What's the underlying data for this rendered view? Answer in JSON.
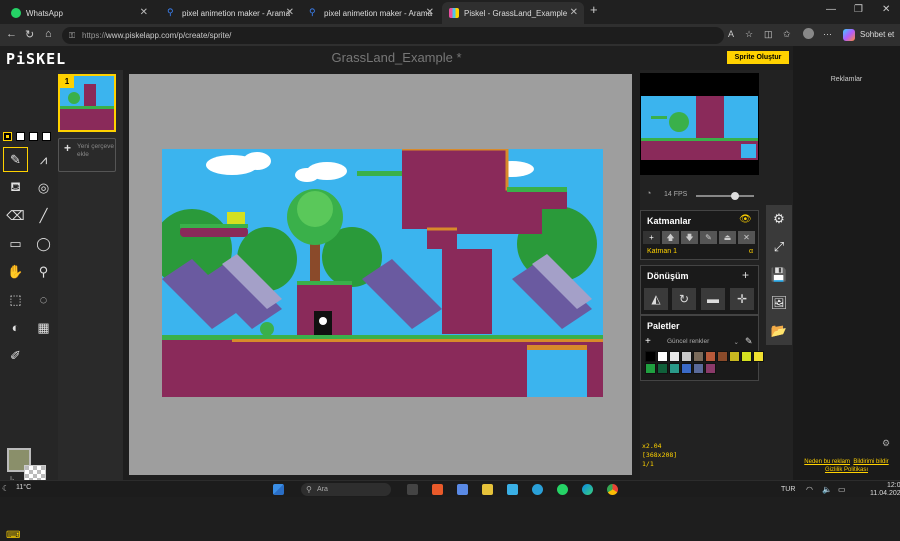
{
  "browser": {
    "tabs": [
      {
        "title": "WhatsApp",
        "color": "#25d366"
      },
      {
        "title": "pixel animetion maker - Arama",
        "color": "#3b82f6"
      },
      {
        "title": "pixel animetion maker - Arama",
        "color": "#3b82f6"
      },
      {
        "title": "Piskel - GrassLand_Example",
        "color": "#e94fa0"
      }
    ],
    "url_prefix": "https://",
    "url": "www.piskelapp.com/p/create/sprite/",
    "chat_button": "Sohbet et"
  },
  "app": {
    "logo": "PiSKEL",
    "title": "GrassLand_Example *",
    "create_button": "Sprite Oluştur"
  },
  "frames": {
    "current_number": "1",
    "add_frame_label": "Yeni çerçeve ekle"
  },
  "tools": [
    {
      "name": "pen-tool",
      "glyph": "✎"
    },
    {
      "name": "mirror-pen-tool",
      "glyph": "⩘"
    },
    {
      "name": "paint-bucket-tool",
      "glyph": "⛾"
    },
    {
      "name": "paint-same-color-tool",
      "glyph": "◎"
    },
    {
      "name": "eraser-tool",
      "glyph": "⌫"
    },
    {
      "name": "stroke-tool",
      "glyph": "╱"
    },
    {
      "name": "rectangle-tool",
      "glyph": "▭"
    },
    {
      "name": "circle-tool",
      "glyph": "◯"
    },
    {
      "name": "move-tool",
      "glyph": "✋"
    },
    {
      "name": "shape-selection-tool",
      "glyph": "⚲"
    },
    {
      "name": "rectangle-selection-tool",
      "glyph": "⬚"
    },
    {
      "name": "lasso-selection-tool",
      "glyph": "◌"
    },
    {
      "name": "lighten-tool",
      "glyph": "◐"
    },
    {
      "name": "dithering-tool",
      "glyph": "▦"
    },
    {
      "name": "color-picker-tool",
      "glyph": "✐"
    }
  ],
  "colors": {
    "primary": "#8a8f6a",
    "accent": "#ffd200"
  },
  "preview": {
    "fps_label": "14 FPS",
    "fps": 14
  },
  "layers": {
    "title": "Katmanlar",
    "items": [
      {
        "name": "Katman 1",
        "opacity": "α"
      }
    ]
  },
  "transform": {
    "title": "Dönüşüm"
  },
  "palettes": {
    "title": "Paletler",
    "selected": "Güncel renkler",
    "swatches": [
      "#000000",
      "#ffffff",
      "#e8e8e8",
      "#c8c8c8",
      "#7a6a5a",
      "#b85a3a",
      "#8a4a2a",
      "#c8b820",
      "#d4e020",
      "#f0e030",
      "#20a040",
      "#10603a",
      "#2a9a8a",
      "#3a6ac8",
      "#5a6a9a",
      "#8a3a6a"
    ]
  },
  "zoom_info": {
    "zoom": "x2.04",
    "size": "[368x208]",
    "frame": "1/1"
  },
  "ads": {
    "title": "Reklamlar",
    "links": [
      "Neden bu reklam",
      "Bildirimi bildir",
      "Gizlilik Politikası"
    ]
  },
  "taskbar": {
    "weather": "11°C",
    "search": "Ara",
    "lang": "TUR",
    "time": "12:03",
    "date": "11.04.2025"
  }
}
